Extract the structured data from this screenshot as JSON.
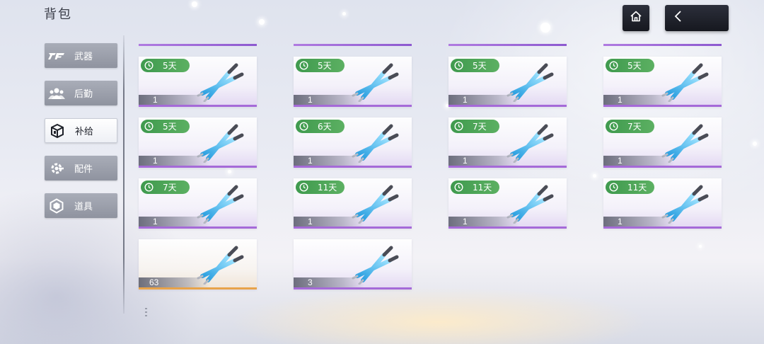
{
  "header": {
    "title": "背包",
    "home_icon": "home-icon",
    "back_icon": "chevron-left-icon"
  },
  "sidebar": {
    "items": [
      {
        "label": "武器",
        "icon": "weapon-icon",
        "active": false
      },
      {
        "label": "后勤",
        "icon": "logistics-icon",
        "active": false
      },
      {
        "label": "补给",
        "icon": "supply-box-icon",
        "active": true
      },
      {
        "label": "配件",
        "icon": "gear-attachment-icon",
        "active": false
      },
      {
        "label": "道具",
        "icon": "hexagon-item-icon",
        "active": false
      }
    ]
  },
  "inventory": {
    "items": [
      {
        "timer": "5天",
        "qty": "1",
        "rarity": "purple"
      },
      {
        "timer": "5天",
        "qty": "1",
        "rarity": "purple"
      },
      {
        "timer": "5天",
        "qty": "1",
        "rarity": "purple"
      },
      {
        "timer": "5天",
        "qty": "1",
        "rarity": "purple"
      },
      {
        "timer": "5天",
        "qty": "1",
        "rarity": "purple"
      },
      {
        "timer": "6天",
        "qty": "1",
        "rarity": "purple"
      },
      {
        "timer": "7天",
        "qty": "1",
        "rarity": "purple"
      },
      {
        "timer": "7天",
        "qty": "1",
        "rarity": "purple"
      },
      {
        "timer": "7天",
        "qty": "1",
        "rarity": "purple"
      },
      {
        "timer": "11天",
        "qty": "1",
        "rarity": "purple"
      },
      {
        "timer": "11天",
        "qty": "1",
        "rarity": "purple"
      },
      {
        "timer": "11天",
        "qty": "1",
        "rarity": "purple"
      },
      {
        "timer": null,
        "qty": "63",
        "rarity": "orange"
      },
      {
        "timer": null,
        "qty": "3",
        "rarity": "purple"
      }
    ]
  },
  "colors": {
    "timer_green": "#4da657",
    "rarity_purple": "#a56ad8",
    "rarity_orange": "#e8a34a",
    "active_tab": "#ffffff",
    "inactive_tab": "#9a9eaa"
  }
}
